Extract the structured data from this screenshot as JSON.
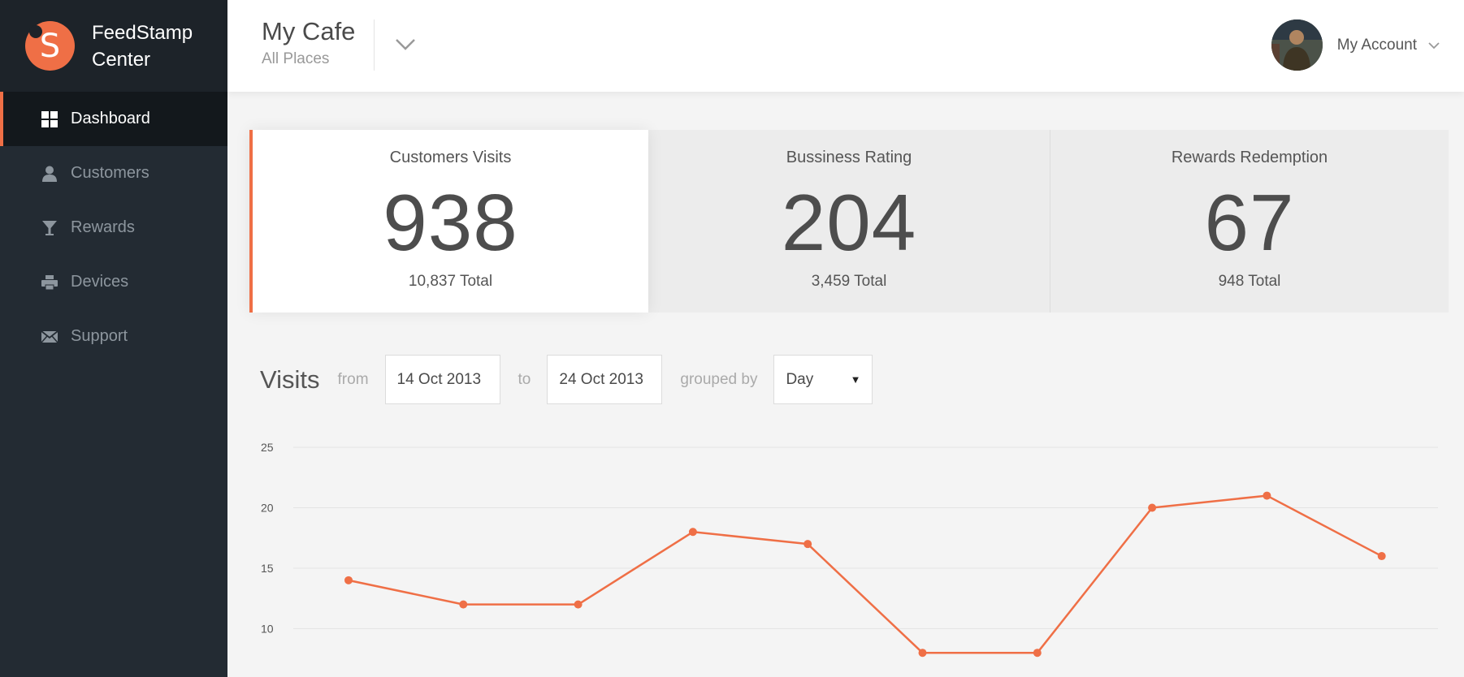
{
  "brand": {
    "logo_letter": "S",
    "name": "FeedStamp Center"
  },
  "sidebar": {
    "items": [
      {
        "label": "Dashboard",
        "icon": "dashboard-icon",
        "active": true
      },
      {
        "label": "Customers",
        "icon": "user-icon",
        "active": false
      },
      {
        "label": "Rewards",
        "icon": "cocktail-icon",
        "active": false
      },
      {
        "label": "Devices",
        "icon": "printer-icon",
        "active": false
      },
      {
        "label": "Support",
        "icon": "envelope-icon",
        "active": false
      }
    ]
  },
  "header": {
    "place_name": "My Cafe",
    "place_sub": "All Places",
    "account_label": "My Account"
  },
  "stats": [
    {
      "label": "Customers Visits",
      "value": "938",
      "total": "10,837 Total"
    },
    {
      "label": "Bussiness Rating",
      "value": "204",
      "total": "3,459 Total"
    },
    {
      "label": "Rewards Redemption",
      "value": "67",
      "total": "948 Total"
    }
  ],
  "visits": {
    "title": "Visits",
    "from_label": "from",
    "from_value": "14 Oct 2013",
    "to_label": "to",
    "to_value": "24 Oct 2013",
    "grouped_label": "grouped by",
    "grouped_value": "Day"
  },
  "colors": {
    "accent": "#ef6f46",
    "sidebar": "#232b33",
    "sidebar_active": "#13181c"
  },
  "chart_data": {
    "type": "line",
    "x": [
      1,
      2,
      3,
      4,
      5,
      6,
      7,
      8,
      9,
      10
    ],
    "series": [
      {
        "values": [
          14,
          12,
          12,
          18,
          17,
          8,
          8,
          20,
          21,
          16
        ]
      }
    ],
    "yticks": [
      10,
      15,
      20,
      25
    ],
    "ylim": [
      6,
      25
    ],
    "grid": true,
    "title": "",
    "xlabel": "",
    "ylabel": ""
  }
}
